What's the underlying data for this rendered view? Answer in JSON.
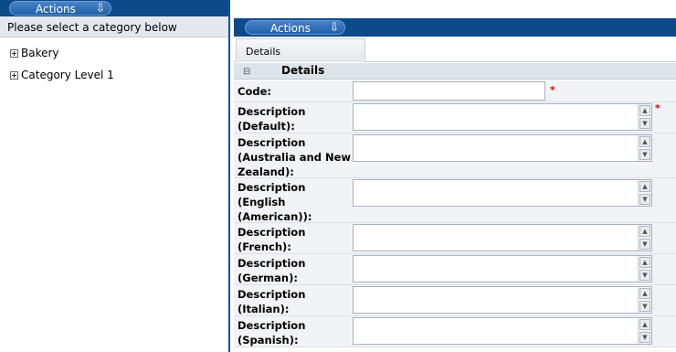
{
  "left_panel": {
    "actions_label": "Actions",
    "prompt": "Please select a category below",
    "tree": [
      {
        "label": "Bakery"
      },
      {
        "label": "Category Level 1"
      }
    ]
  },
  "right_panel": {
    "actions_label": "Actions",
    "tab_label": "Details",
    "section_title": "Details",
    "fields": [
      {
        "label": "Code:",
        "value": "",
        "required": true,
        "multiline": false
      },
      {
        "label": "Description (Default):",
        "value": "",
        "required": true,
        "multiline": true
      },
      {
        "label": "Description (Australia and New Zealand):",
        "value": "",
        "required": false,
        "multiline": true
      },
      {
        "label": "Description (English (American)):",
        "value": "",
        "required": false,
        "multiline": true
      },
      {
        "label": "Description (French):",
        "value": "",
        "required": false,
        "multiline": true
      },
      {
        "label": "Description (German):",
        "value": "",
        "required": false,
        "multiline": true
      },
      {
        "label": "Description (Italian):",
        "value": "",
        "required": false,
        "multiline": true
      },
      {
        "label": "Description (Spanish):",
        "value": "",
        "required": false,
        "multiline": true
      }
    ],
    "required_marker": "*"
  },
  "icons": {
    "actions_arrow": "arrow-down-icon",
    "tree_expand": "plus-box-icon",
    "section_collapse": "minus-icon"
  }
}
